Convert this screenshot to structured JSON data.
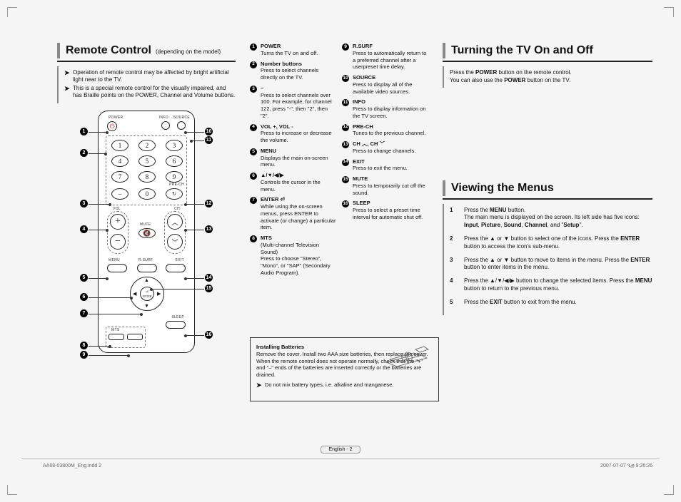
{
  "sec1": {
    "title": "Remote Control",
    "sub": "(depending on the model)"
  },
  "notes": {
    "a": "Operation of remote control may be affected by bright artificial light near to the TV.",
    "b": "This is a special remote control for the visually impaired, and has Braille points on the POWER, Channel and Volume buttons."
  },
  "items": [
    {
      "t": "POWER",
      "d": "Turns the TV on and off."
    },
    {
      "t": "Number buttons",
      "d": "Press to select channels directly on the TV."
    },
    {
      "t": "–",
      "d": "Press to select channels over 100. For example, for channel 122, press \"-\", then \"2\", then \"2\"."
    },
    {
      "t": "VOL +, VOL -",
      "d": "Press to increase or decrease the volume."
    },
    {
      "t": "MENU",
      "d": "Displays the main on-screen menu."
    },
    {
      "t": "▲/▼/◀/▶",
      "d": "Controls the cursor in the menu."
    },
    {
      "t": "ENTER ⏎",
      "d": "While using the on-screen menus, press ENTER to activate (or change) a particular item."
    },
    {
      "t": "MTS",
      "d": "(Multi-channel Television Sound)\nPress to choose \"Stereo\", \"Mono\", or \"SAP\" (Secondary Audio Program)."
    },
    {
      "t": "R.SURF",
      "d": "Press to automatically return to a preferred channel after a userpreset time delay."
    },
    {
      "t": "SOURCE",
      "d": "Press to display all of the available video sources."
    },
    {
      "t": "INFO",
      "d": "Press to display information on the TV screen."
    },
    {
      "t": "PRE-CH",
      "d": "Tunes to the previous channel."
    },
    {
      "t": "CH ︿, CH ﹀",
      "d": "Press to change channels."
    },
    {
      "t": "EXIT",
      "d": "Press to exit the menu."
    },
    {
      "t": "MUTE",
      "d": "Press to temporarily cut off the sound."
    },
    {
      "t": "SLEEP",
      "d": "Press to select a preset time interval for automatic shut off."
    }
  ],
  "inst": {
    "h": "Installing Batteries",
    "a": "Remove the cover. Install two AAA size batteries, then replace the cover.",
    "b": "When the remote control does not operate normally, check that the \"+\" and \"–\" ends of the batteries are inserted correctly or the batteries are drained.",
    "c": "Do not mix battery types, i.e. alkaline and manganese."
  },
  "sec2": {
    "title": "Turning the TV On and Off",
    "body_a": "Press the ",
    "body_b": " button on the remote control.",
    "body_c": "You can also use the ",
    "body_d": " button on the TV.",
    "pw": "POWER"
  },
  "sec3": {
    "title": "Viewing the Menus",
    "steps": [
      {
        "t": "Press the MENU button.\nThe main menu is displayed on the screen. Its left side has five icons: Input, Picture, Sound, Channel, and \"Setup\"."
      },
      {
        "t": "Press the ▲ or ▼ button to select one of the icons. Press the ENTER button to access the icon's sub-menu."
      },
      {
        "t": "Press the ▲ or ▼ button to move to items in the menu. Press the ENTER button to enter items in the menu."
      },
      {
        "t": "Press the ▲/▼/◀/▶ button to change the selected items. Press the MENU button to return to the previous menu."
      },
      {
        "t": "Press the EXIT button to exit from the menu."
      }
    ]
  },
  "remote": {
    "power": "POWER",
    "info": "INFO",
    "source": "SOURCE",
    "vol": "VOL",
    "ch": "CH",
    "prech": "PRE-CH",
    "mute": "MUTE",
    "menu": "MENU",
    "rsurf": "R.SURF",
    "exit": "EXIT",
    "enter": "ENTER",
    "sleep": "SLEEP",
    "mts": "MTS",
    "n1": "1",
    "n2": "2",
    "n3": "3",
    "n4": "4",
    "n5": "5",
    "n6": "6",
    "n7": "7",
    "n8": "8",
    "n9": "9",
    "n0": "0",
    "dash": "–",
    "plus": "+",
    "minus": "−",
    "up": "︿",
    "dn": "﹀"
  },
  "ft": {
    "page": "English - 2",
    "file": "AA68-03800M_Eng.indd   2",
    "ts": "2007-07-07   ዒ፴ 9:26:26"
  }
}
